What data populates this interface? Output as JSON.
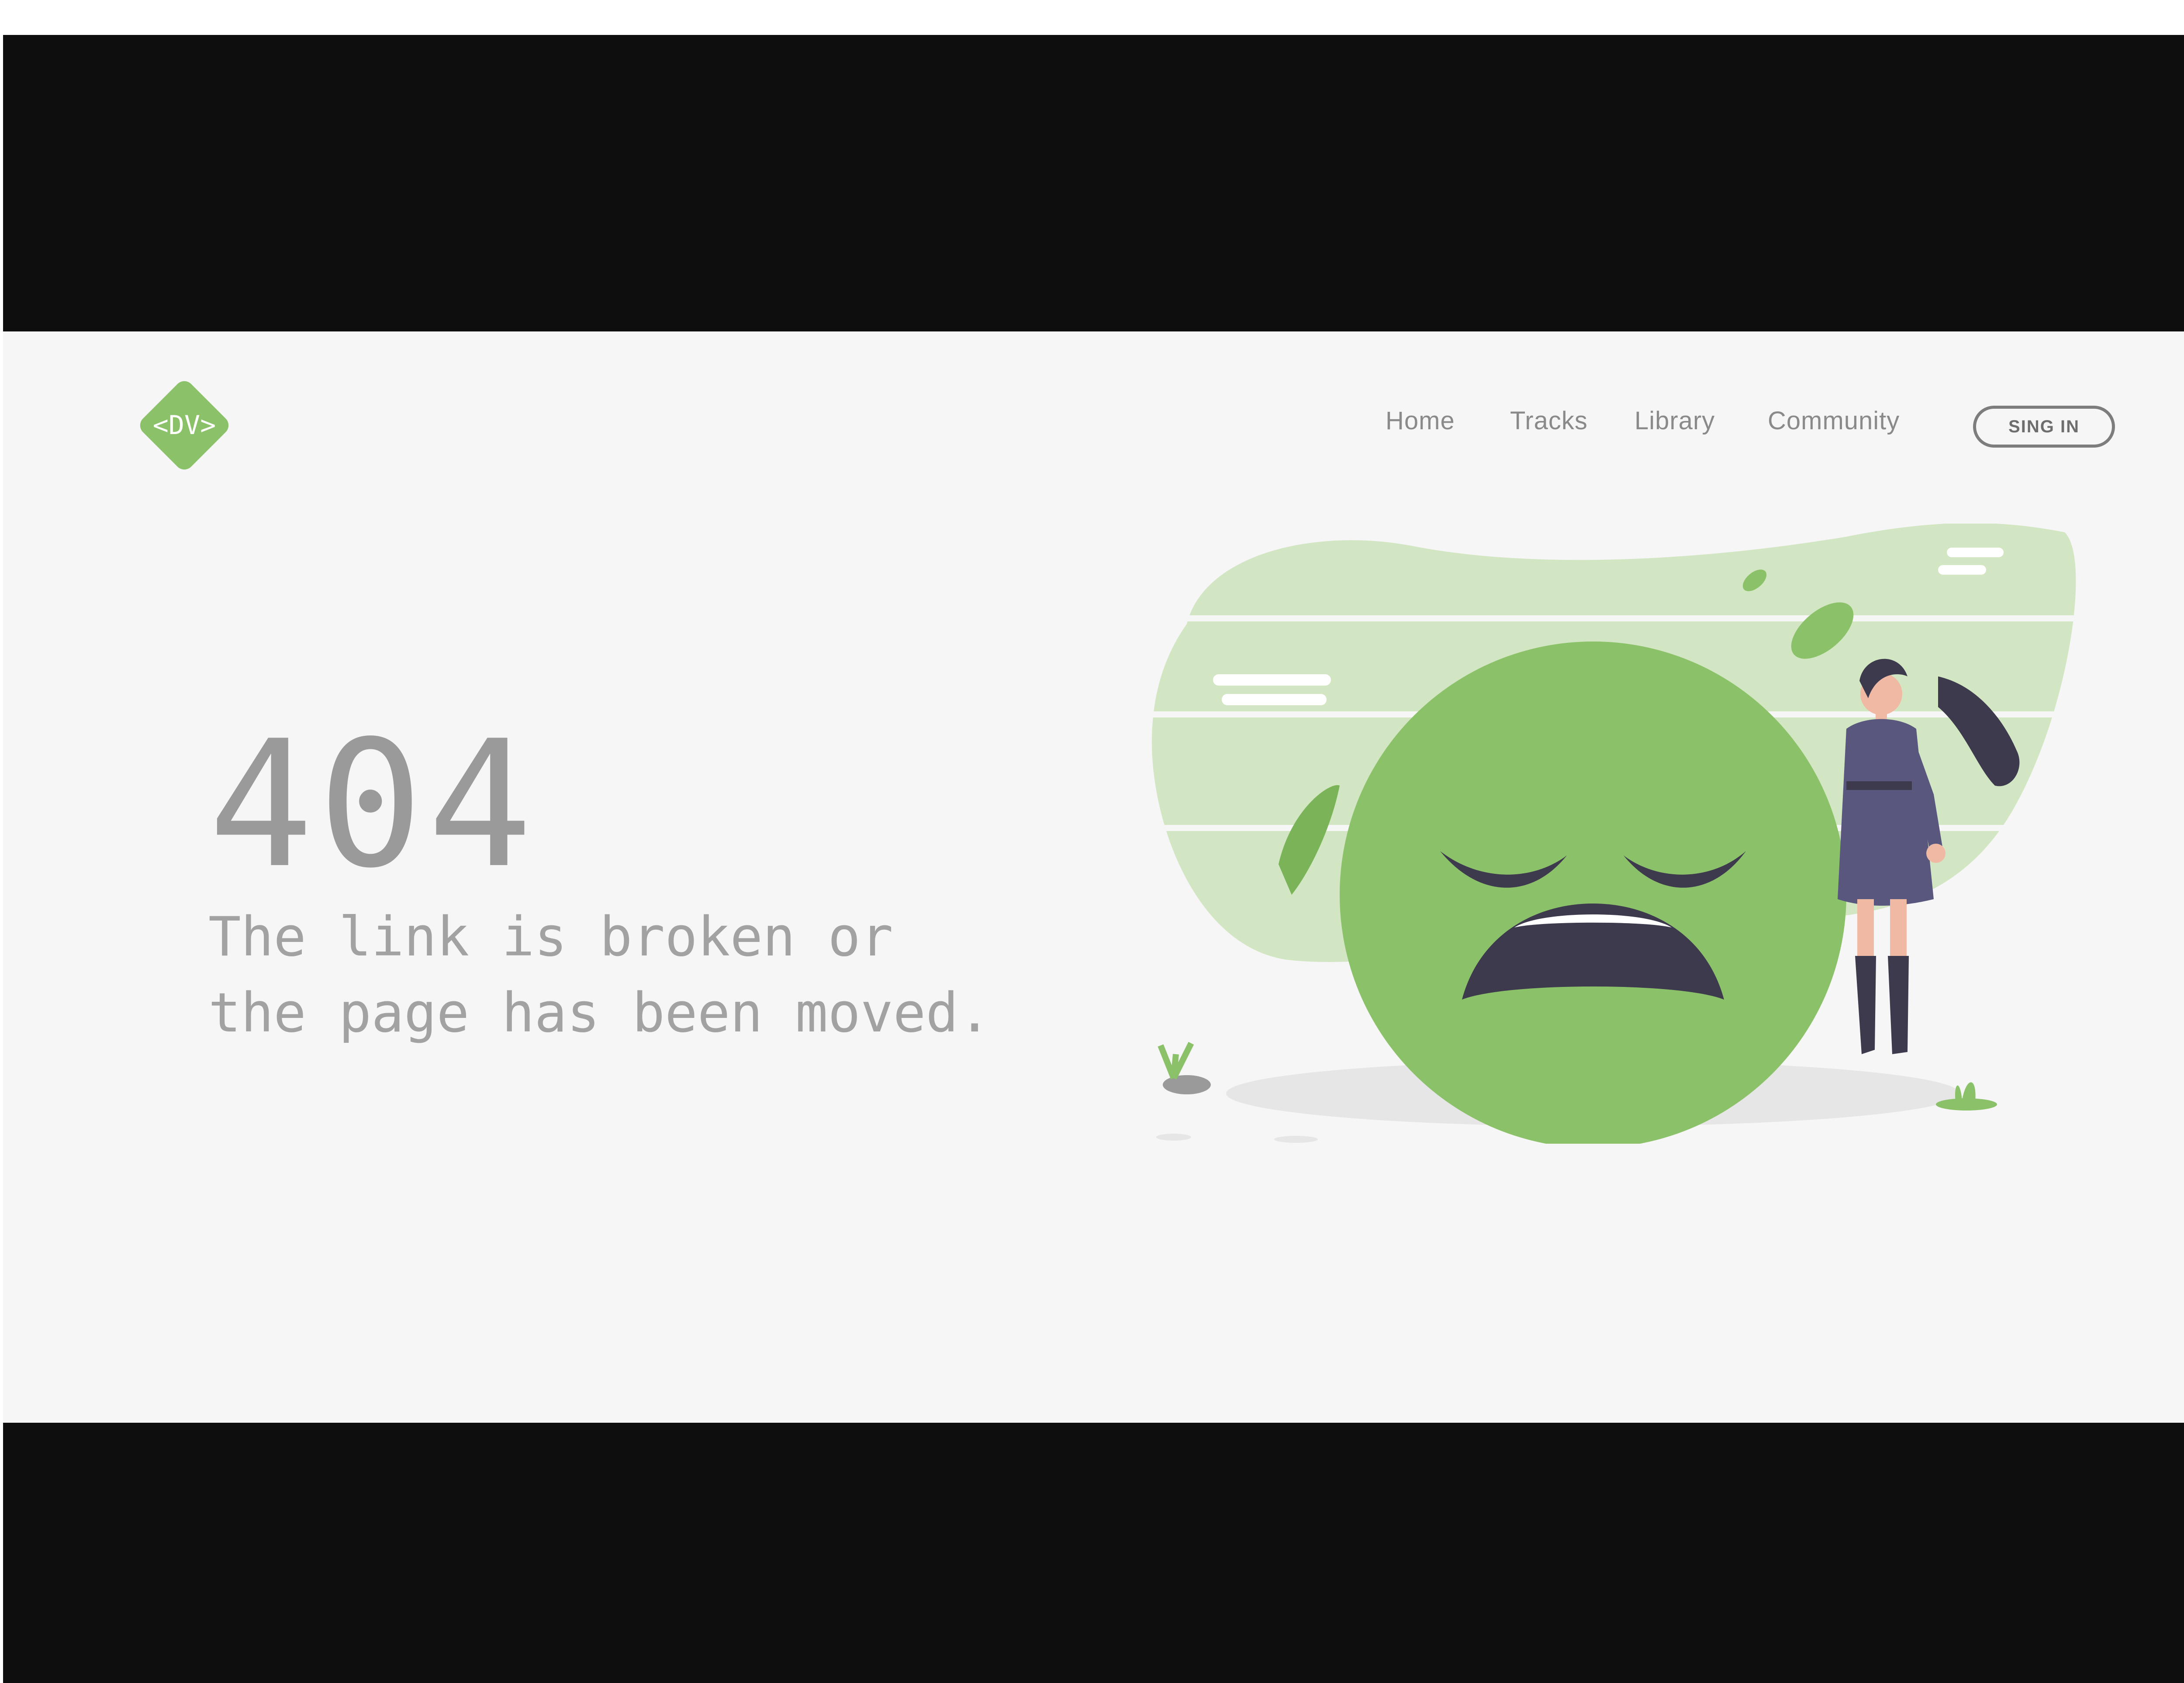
{
  "header": {
    "logo_text": "<DV>",
    "nav": [
      {
        "label": "Home"
      },
      {
        "label": "Tracks"
      },
      {
        "label": "Library"
      },
      {
        "label": "Community"
      }
    ],
    "signin_label": "SING IN"
  },
  "error": {
    "code": "404",
    "message_line1": "The link is broken or",
    "message_line2": "the page has been moved."
  },
  "colors": {
    "brand_green": "#8bc168",
    "light_green": "#d2e6c3",
    "figure_purple": "#5a577f",
    "text_gray": "#9a9a9a",
    "letterbox": "#0e0e0e",
    "page_background": "#f6f6f6"
  },
  "icons": {
    "logo": "dv-diamond-logo",
    "illustration": "sad-face-emoji-with-woman"
  }
}
